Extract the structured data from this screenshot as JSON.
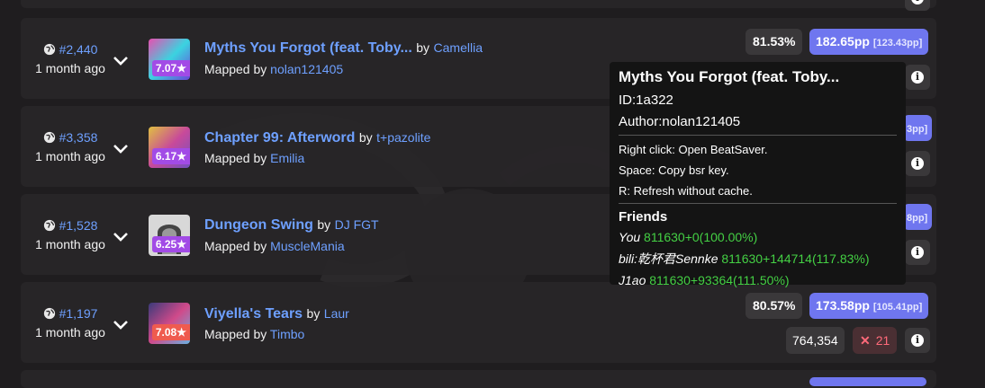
{
  "rows": [
    {
      "rank": "#2,440",
      "time_ago": "1 month ago",
      "title": "Myths You Forgot (feat. Toby...",
      "by": "by",
      "artist": "Camellia",
      "mapped_by": "Mapped by",
      "mapper": "nolan121405",
      "stars": "7.07★",
      "star_color": "#a24be6",
      "accuracy": "81.53%",
      "pp": "182.65pp",
      "pp_raw": "[123.43pp]"
    },
    {
      "rank": "#3,358",
      "time_ago": "1 month ago",
      "title": "Chapter 99: Afterword",
      "by": "by",
      "artist": "t+pazolite",
      "mapped_by": "Mapped by",
      "mapper": "Emilia",
      "stars": "6.17★",
      "star_color": "#a24be6",
      "pp_partial": "3pp]"
    },
    {
      "rank": "#1,528",
      "time_ago": "1 month ago",
      "title": "Dungeon Swing",
      "by": "by",
      "artist": "DJ FGT",
      "mapped_by": "Mapped by",
      "mapper": "MuscleMania",
      "stars": "6.25★",
      "star_color": "#a24be6",
      "pp_partial": "8pp]"
    },
    {
      "rank": "#1,197",
      "time_ago": "1 month ago",
      "title": "Viyella's Tears",
      "by": "by",
      "artist": "Laur",
      "mapped_by": "Mapped by",
      "mapper": "Timbo",
      "stars": "7.08★",
      "star_color": "#ef5b4f",
      "accuracy": "80.57%",
      "pp": "173.58pp",
      "pp_raw": "[105.41pp]",
      "score": "764,354",
      "misses": "21"
    }
  ],
  "tooltip": {
    "title": "Myths You Forgot (feat. Toby...",
    "id": "ID:1a322",
    "author": "Author:nolan121405",
    "hint_right_click": "Right click: Open BeatSaver.",
    "hint_space": "Space: Copy bsr key.",
    "hint_r": "R: Refresh without cache.",
    "friends_label": "Friends",
    "friends": [
      {
        "name": "You",
        "value": "811630+0(100.00%)"
      },
      {
        "name": "bili:乾杯君Sennke",
        "value": "811630+144714(117.83%)"
      },
      {
        "name": "J1ao",
        "value": "811630+93364(111.50%)"
      }
    ]
  },
  "colors": {
    "link": "#6ea0ff",
    "pp_badge": "#6f76ef",
    "friend_value": "#44d044",
    "miss": "#ff6a7a"
  },
  "icons": [
    "globe-icon",
    "chevron-down-icon",
    "info-icon",
    "miss-x-icon"
  ]
}
